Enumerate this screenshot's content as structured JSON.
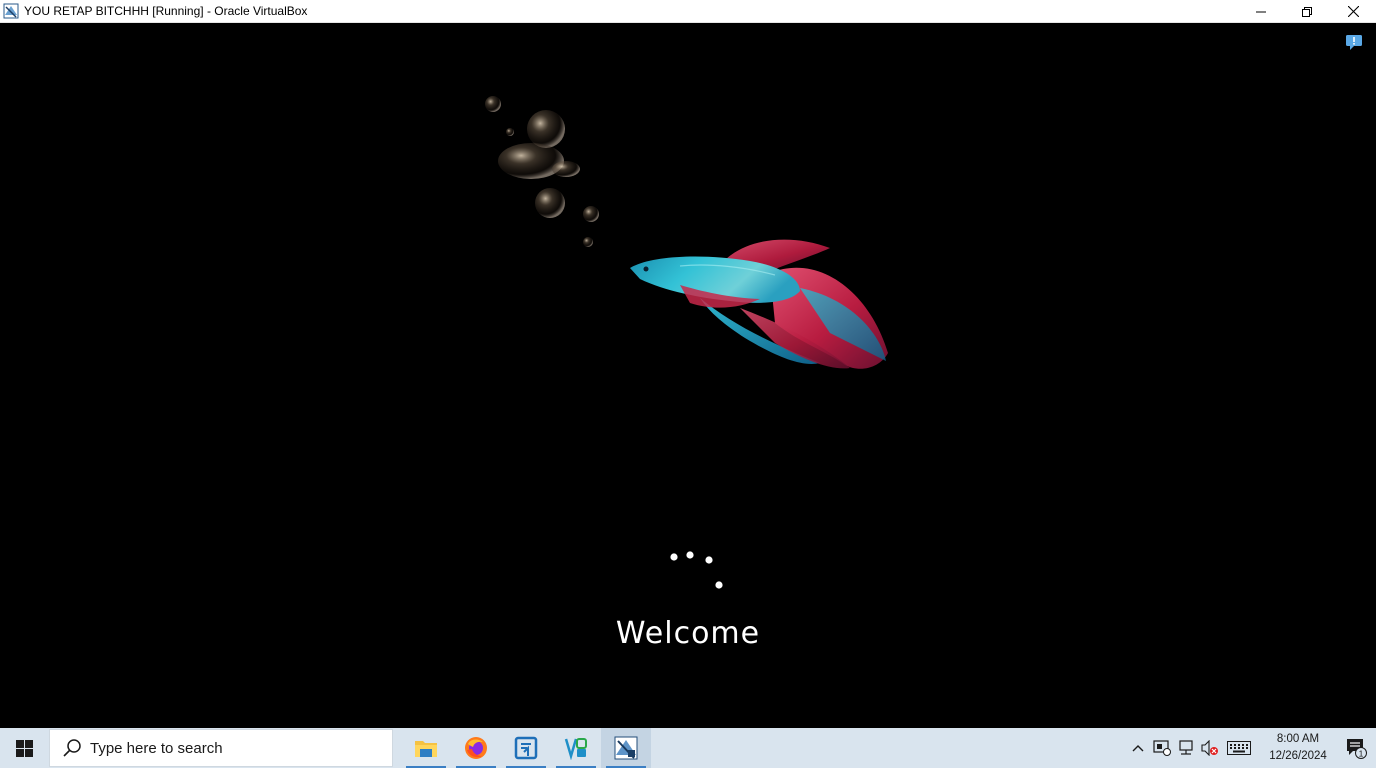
{
  "window": {
    "title": "YOU RETAP BITCHHH [Running] - Oracle VirtualBox",
    "minimize_label": "—",
    "restore_label": "❐",
    "close_label": "✕"
  },
  "vm": {
    "welcome_text": "Welcome"
  },
  "taskbar": {
    "search_placeholder": "Type here to search",
    "apps": [
      {
        "name": "File Explorer",
        "icon": "folder-icon"
      },
      {
        "name": "Firefox",
        "icon": "firefox-icon"
      },
      {
        "name": "App 3",
        "icon": "app-blue-icon"
      },
      {
        "name": "App 4",
        "icon": "app-vs-icon"
      },
      {
        "name": "VirtualBox",
        "icon": "virtualbox-icon"
      }
    ],
    "clock": {
      "time": "8:00 AM",
      "date": "12/26/2024"
    },
    "notification_count": "1"
  },
  "colors": {
    "taskbar_bg": "#d9e4ee",
    "screen_bg": "#000000",
    "fish_teal": "#2ab5c9",
    "fish_red": "#c8284a",
    "running_indicator": "#3b7fc4"
  }
}
